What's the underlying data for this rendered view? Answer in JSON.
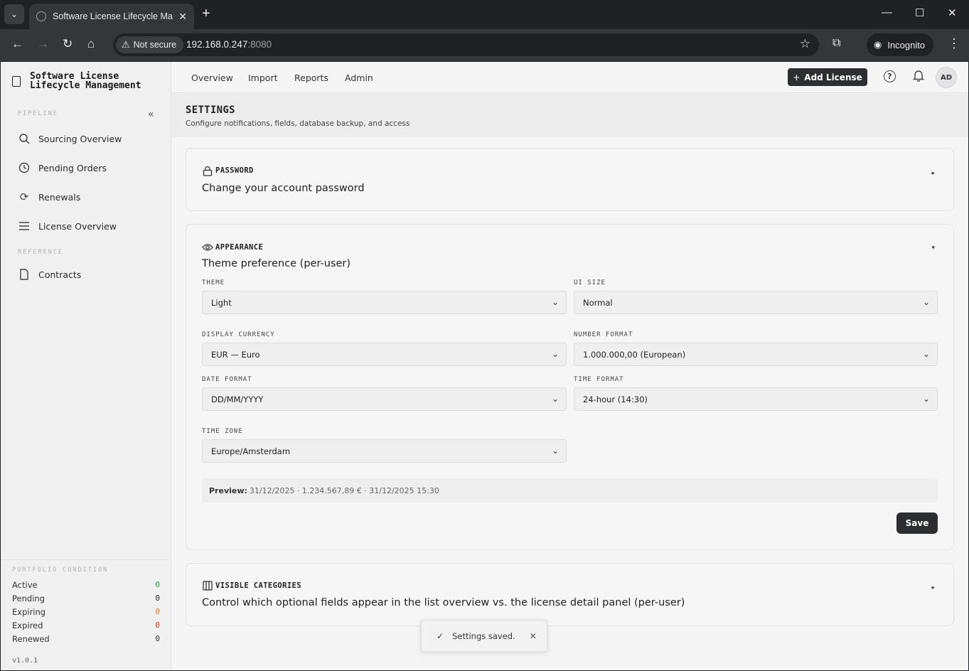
{
  "browser": {
    "tab_title": "Software License Lifecycle Management",
    "not_secure_label": "Not secure",
    "url_host": "192.168.0.247",
    "url_port": ":8080",
    "incognito_label": "Incognito"
  },
  "app": {
    "brand_title": "Software License Lifecycle Management",
    "sidebar": {
      "pipeline_label": "PIPELINE",
      "pipeline_items": [
        {
          "label": "Sourcing Overview",
          "icon": "search-icon"
        },
        {
          "label": "Pending Orders",
          "icon": "clock-icon"
        },
        {
          "label": "Renewals",
          "icon": "refresh-icon"
        },
        {
          "label": "License Overview",
          "icon": "list-icon"
        }
      ],
      "reference_label": "REFERENCE",
      "reference_items": [
        {
          "label": "Contracts",
          "icon": "document-icon"
        }
      ],
      "portfolio_label": "PORTFOLIO CONDITION",
      "portfolio": [
        {
          "label": "Active",
          "value": "0",
          "color": "#2e9e5b"
        },
        {
          "label": "Pending",
          "value": "0",
          "color": "#333333"
        },
        {
          "label": "Expiring",
          "value": "0",
          "color": "#e07b1f"
        },
        {
          "label": "Expired",
          "value": "0",
          "color": "#d93a2b"
        },
        {
          "label": "Renewed",
          "value": "0",
          "color": "#333333"
        }
      ],
      "version": "v1.0.1"
    },
    "topnav": {
      "links": [
        "Overview",
        "Import",
        "Reports",
        "Admin"
      ],
      "add_license_label": "Add License",
      "avatar_initials": "AD"
    },
    "page": {
      "title": "SETTINGS",
      "subtitle": "Configure notifications, fields, database backup, and access"
    },
    "password_card": {
      "title": "PASSWORD",
      "description": "Change your account password"
    },
    "appearance_card": {
      "title": "APPEARANCE",
      "description": "Theme preference (per-user)",
      "fields": {
        "theme": {
          "label": "THEME",
          "value": "Light"
        },
        "ui_size": {
          "label": "UI SIZE",
          "value": "Normal"
        },
        "display_currency": {
          "label": "DISPLAY CURRENCY",
          "value": "EUR — Euro"
        },
        "number_format": {
          "label": "NUMBER FORMAT",
          "value": "1.000.000,00 (European)"
        },
        "date_format": {
          "label": "DATE FORMAT",
          "value": "DD/MM/YYYY"
        },
        "time_format": {
          "label": "TIME FORMAT",
          "value": "24-hour (14:30)"
        },
        "time_zone": {
          "label": "TIME ZONE",
          "value": "Europe/Amsterdam"
        }
      },
      "preview_label": "Preview:",
      "preview_value": "31/12/2025 · 1.234.567,89 € · 31/12/2025 15:30",
      "save_label": "Save"
    },
    "categories_card": {
      "title": "VISIBLE CATEGORIES",
      "description": "Control which optional fields appear in the list overview vs. the license detail panel (per-user)"
    },
    "toast": {
      "message": "Settings saved."
    }
  }
}
